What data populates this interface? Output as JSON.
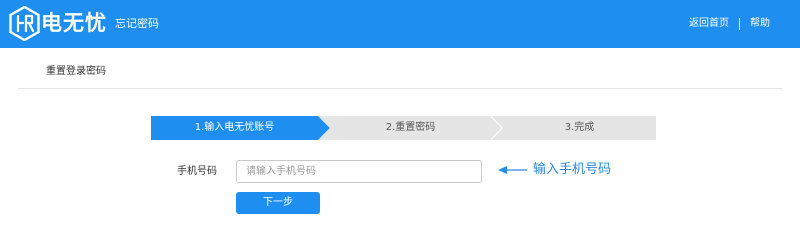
{
  "header": {
    "brand": "电无忧",
    "subtitle": "忘记密码",
    "nav": {
      "home": "返回首页",
      "help": "帮助"
    }
  },
  "section": {
    "title": "重置登录密码"
  },
  "steps": [
    {
      "label": "1.输入电无忧账号",
      "state": "active"
    },
    {
      "label": "2.重置密码",
      "state": "inactive"
    },
    {
      "label": "3.完成",
      "state": "inactive"
    }
  ],
  "form": {
    "phone_label": "手机号码",
    "phone_placeholder": "请输入手机号码",
    "phone_value": "",
    "next_label": "下一步"
  },
  "hint": {
    "text": "输入手机号码"
  },
  "colors": {
    "primary": "#1e8ef0",
    "step_inactive": "#e5e5e5",
    "hint": "#2a8be4"
  }
}
